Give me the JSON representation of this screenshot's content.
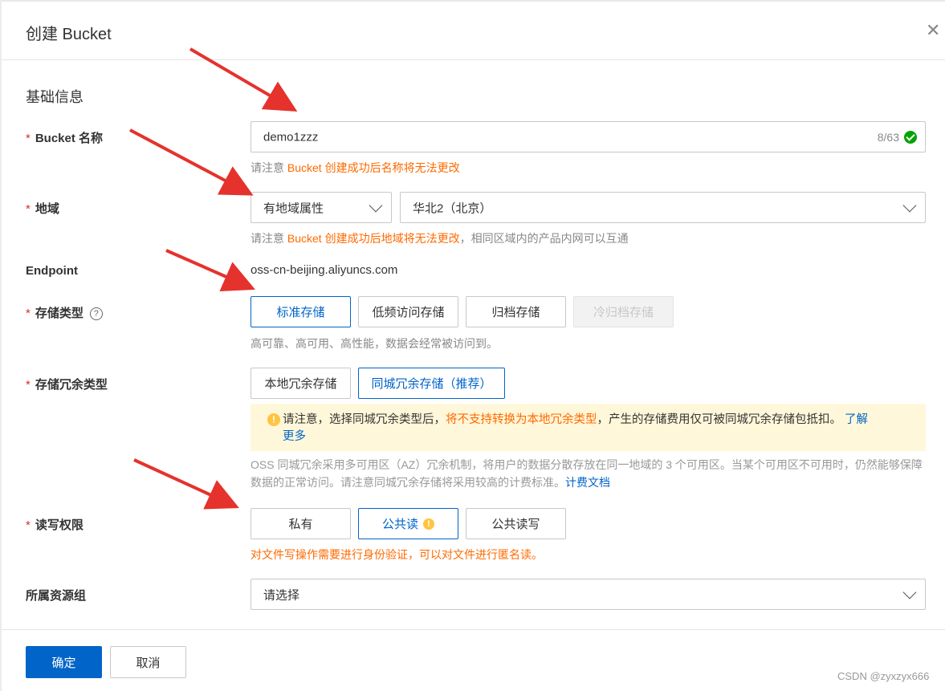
{
  "dialog": {
    "title": "创建 Bucket"
  },
  "section": {
    "title": "基础信息"
  },
  "bucket_name": {
    "label": "Bucket 名称",
    "value": "demo1zzz",
    "count": "8/63",
    "hint_prefix": "请注意 ",
    "hint_orange": "Bucket 创建成功后名称将无法更改"
  },
  "region": {
    "label": "地域",
    "type_value": "有地域属性",
    "region_value": "华北2（北京）",
    "hint_prefix": "请注意 ",
    "hint_orange": "Bucket 创建成功后地域将无法更改",
    "hint_suffix": "，相同区域内的产品内网可以互通"
  },
  "endpoint": {
    "label": "Endpoint",
    "value": "oss-cn-beijing.aliyuncs.com"
  },
  "storage_class": {
    "label": "存储类型",
    "options": [
      "标准存储",
      "低频访问存储",
      "归档存储",
      "冷归档存储"
    ],
    "selected": "标准存储",
    "hint": "高可靠、高可用、高性能，数据会经常被访问到。"
  },
  "redundancy": {
    "label": "存储冗余类型",
    "options": [
      "本地冗余存储",
      "同城冗余存储（推荐）"
    ],
    "selected": "同城冗余存储（推荐）",
    "warn_prefix": "请注意，选择同城冗余类型后，",
    "warn_orange": "将不支持转换为本地冗余类型",
    "warn_suffix": "，产生的存储费用仅可被同城冗余存储包抵扣。",
    "warn_link_1": "了解",
    "warn_link_2": "更多",
    "desc": "OSS 同城冗余采用多可用区（AZ）冗余机制，将用户的数据分散存放在同一地域的 3 个可用区。当某个可用区不可用时，仍然能够保障数据的正常访问。请注意同城冗余存储将采用较高的计费标准。",
    "desc_link": "计费文档"
  },
  "acl": {
    "label": "读写权限",
    "options": [
      "私有",
      "公共读",
      "公共读写"
    ],
    "selected": "公共读",
    "hint": "对文件写操作需要进行身份验证，可以对文件进行匿名读。"
  },
  "resource_group": {
    "label": "所属资源组",
    "placeholder": "请选择"
  },
  "footer": {
    "confirm": "确定",
    "cancel": "取消"
  },
  "watermark": "CSDN @zyxzyx666",
  "colors": {
    "primary": "#0064c8",
    "warning_orange": "#ff6a00",
    "required": "#d93026",
    "warning_bg": "#fff7d9",
    "annotation_arrow": "#e5322d"
  }
}
